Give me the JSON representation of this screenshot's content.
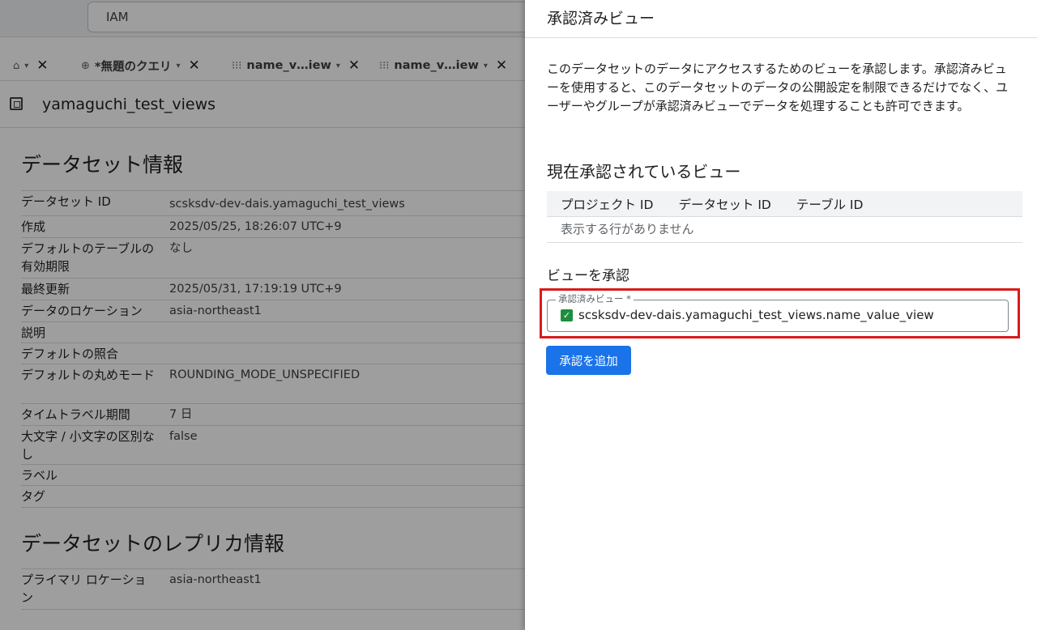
{
  "topbar": {
    "search_value": "IAM"
  },
  "tabs": [
    {
      "icon": "⌂",
      "label": "",
      "caret": "▾",
      "close": "✕"
    },
    {
      "icon": "⊕",
      "label": "*無題のクエリ",
      "caret": "▾",
      "close": "✕"
    },
    {
      "icon": "⁝⁝⁝",
      "label": "name_v…iew",
      "caret": "▾",
      "close": "✕"
    },
    {
      "icon": "⁝⁝⁝",
      "label": "name_v…iew",
      "caret": "▾",
      "close": "✕"
    }
  ],
  "dataset": {
    "name": "yamaguchi_test_views",
    "info_title": "データセット情報",
    "info_rows": [
      {
        "key": "データセット ID",
        "value": "scsksdv-dev-dais.yamaguchi_test_views"
      },
      {
        "key": "作成",
        "value": "2025/05/25, 18:26:07 UTC+9"
      },
      {
        "key": "デフォルトのテーブルの有効期限",
        "value": "なし"
      },
      {
        "key": "最終更新",
        "value": "2025/05/31, 17:19:19 UTC+9"
      },
      {
        "key": "データのロケーション",
        "value": "asia-northeast1"
      },
      {
        "key": "説明",
        "value": ""
      },
      {
        "key": "デフォルトの照合",
        "value": ""
      },
      {
        "key": "デフォルトの丸めモード",
        "value": "ROUNDING_MODE_UNSPECIFIED"
      },
      {
        "key": "タイムトラベル期間",
        "value": "7 日"
      },
      {
        "key": "大文字 / 小文字の区別なし",
        "value": "false"
      },
      {
        "key": "ラベル",
        "value": ""
      },
      {
        "key": "タグ",
        "value": ""
      }
    ],
    "replica_title": "データセットのレプリカ情報",
    "replica_rows": [
      {
        "key": "プライマリ ロケーション",
        "value": "asia-northeast1"
      }
    ]
  },
  "panel": {
    "title": "承認済みビュー",
    "description": "このデータセットのデータにアクセスするためのビューを承認します。承認済みビューを使用すると、このデータセットのデータの公開設定を制限できるだけでなく、ユーザーやグループが承認済みビューでデータを処理することも許可できます。",
    "current_title": "現在承認されているビュー",
    "columns": [
      "プロジェクト ID",
      "データセット ID",
      "テーブル ID"
    ],
    "empty_text": "表示する行がありません",
    "authorize_title": "ビューを承認",
    "field_label": "承認済みビュー *",
    "field_value": "scsksdv-dev-dais.yamaguchi_test_views.name_value_view",
    "add_button": "承認を追加"
  },
  "colors": {
    "primary": "#1a73e8",
    "highlight": "#d81b1b",
    "check": "#1e8e3e"
  }
}
